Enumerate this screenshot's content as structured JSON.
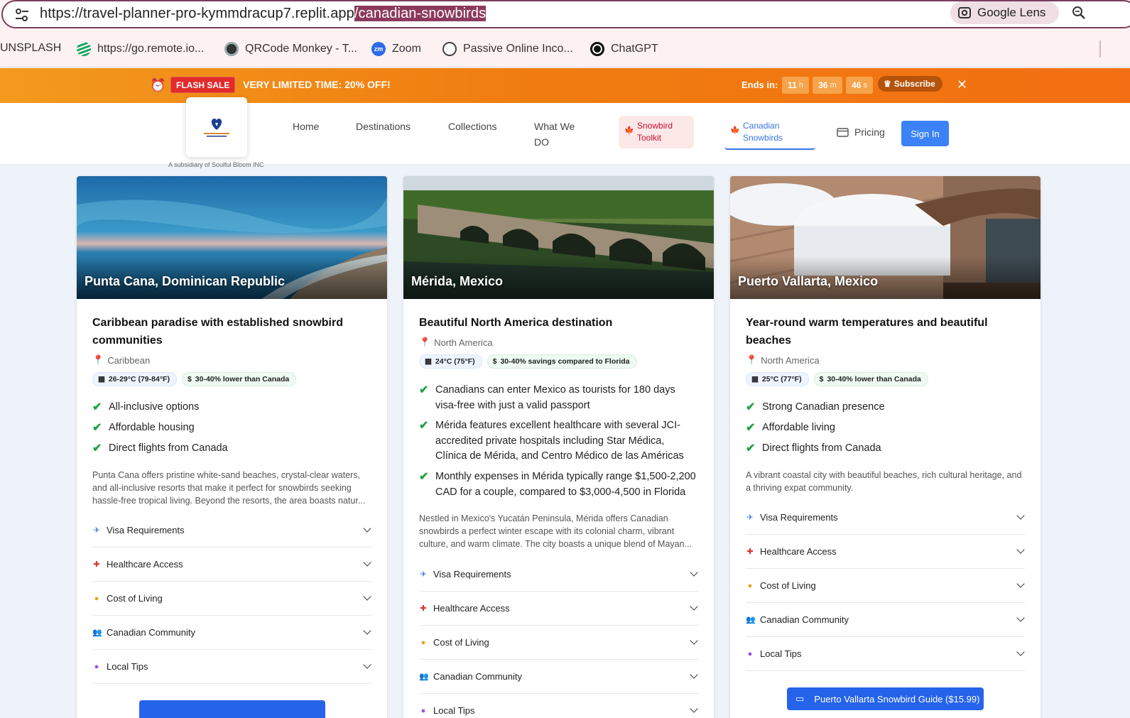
{
  "browser": {
    "url_base": "https://travel-planner-pro-kymmdracup7.replit.app",
    "url_path": "/canadian-snowbirds",
    "lens_label": "Google Lens",
    "bookmarks": [
      {
        "label": "UNSPLASH",
        "icon": "none"
      },
      {
        "label": "https://go.remote.io...",
        "icon": "remote-io-icon"
      },
      {
        "label": "QRCode Monkey - T...",
        "icon": "qrcode-monkey-icon"
      },
      {
        "label": "Zoom",
        "icon": "zoom-icon"
      },
      {
        "label": "Passive Online Inco...",
        "icon": "openai-icon"
      },
      {
        "label": "ChatGPT",
        "icon": "chatgpt-icon"
      }
    ]
  },
  "flash": {
    "badge": "FLASH SALE",
    "text": "VERY LIMITED TIME:  20% OFF!",
    "ends_label": "Ends in:",
    "hours": "11",
    "hours_unit": "h",
    "minutes": "36",
    "minutes_unit": "m",
    "seconds": "46",
    "seconds_unit": "s",
    "subscribe": "Subscribe"
  },
  "nav": {
    "subsidiary": "A subsidiary of Soulful Bloom INC",
    "home": "Home",
    "destinations": "Destinations",
    "collections": "Collections",
    "what_we_do_1": "What We",
    "what_we_do_2": "DO",
    "toolkit_1": "Snowbird",
    "toolkit_2": "Toolkit",
    "snowbirds_1": "Canadian",
    "snowbirds_2": "Snowbirds",
    "pricing": "Pricing",
    "signin": "Sign In"
  },
  "accordion": {
    "visa": "Visa Requirements",
    "health": "Healthcare Access",
    "cost": "Cost of Living",
    "community": "Canadian Community",
    "tips": "Local Tips"
  },
  "cards": [
    {
      "title": "Punta Cana, Dominican Republic",
      "tagline": "Caribbean paradise with established snowbird communities",
      "region": "Caribbean",
      "temp": "26-29°C (79-84°F)",
      "cost": "30-40% lower than Canada",
      "features": [
        "All-inclusive options",
        "Affordable housing",
        "Direct flights from Canada"
      ],
      "description": "Punta Cana offers pristine white-sand beaches, crystal-clear waters, and all-inclusive resorts that make it perfect for snowbirds seeking hassle-free tropical living. Beyond the resorts, the area boasts natur..."
    },
    {
      "title": "Mérida, Mexico",
      "tagline": "Beautiful North America destination",
      "region": "North America",
      "temp": "24°C (75°F)",
      "cost": "30-40% savings compared to Florida",
      "features": [
        "Canadians can enter Mexico as tourists for 180 days visa-free with just a valid passport",
        "Mérida features excellent healthcare with several JCI-accredited private hospitals including Star Médica, Clínica de Mérida, and Centro Médico de las Américas",
        "Monthly expenses in Mérida typically range $1,500-2,200 CAD for a couple, compared to $3,000-4,500 in Florida"
      ],
      "description": "Nestled in Mexico's Yucatán Peninsula, Mérida offers Canadian snowbirds a perfect winter escape with its colonial charm, vibrant culture, and warm climate. The city boasts a unique blend of Mayan..."
    },
    {
      "title": "Puerto Vallarta, Mexico",
      "tagline": "Year-round warm temperatures and beautiful beaches",
      "region": "North America",
      "temp": "25°C (77°F)",
      "cost": "30-40% lower than Canada",
      "features": [
        "Strong Canadian presence",
        "Affordable living",
        "Direct flights from Canada"
      ],
      "description": "A vibrant coastal city with beautiful beaches, rich cultural heritage, and a thriving expat community.",
      "guide_button": "Puerto Vallarta Snowbird Guide ($15.99)"
    }
  ],
  "colors": {
    "accent": "#3b82f6",
    "flash": "#f07d10",
    "check": "#22a34a",
    "canada_red": "#c8102e"
  }
}
